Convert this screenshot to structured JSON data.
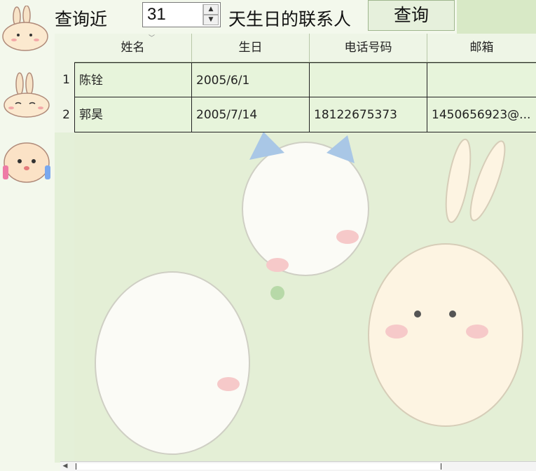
{
  "toolbar": {
    "label_before": "查询近",
    "days_value": "31",
    "label_after": "天生日的联系人",
    "query_button": "查询"
  },
  "table": {
    "columns": [
      "姓名",
      "生日",
      "电话号码",
      "邮箱"
    ],
    "rows": [
      {
        "num": "1",
        "name": "陈铨",
        "birthday": "2005/6/1",
        "phone": "",
        "email": ""
      },
      {
        "num": "2",
        "name": "郭昊",
        "birthday": "2005/7/14",
        "phone": "18122675373",
        "email": "1450656923@..."
      }
    ]
  },
  "icons": {
    "spin_up": "chevron-up-icon",
    "spin_down": "chevron-down-icon",
    "scroll_left": "scroll-left-icon"
  },
  "colors": {
    "background": "#f3f8ec",
    "grid_bg": "#e4f0d8",
    "button_bg": "#e6f0dc"
  }
}
